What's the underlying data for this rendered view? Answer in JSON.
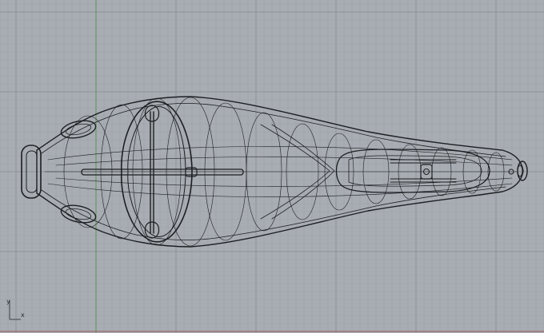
{
  "viewport": {
    "background": "#a8adb3",
    "grid_minor_color": "#9ba0a6",
    "grid_major_color": "#8e949a",
    "y_axis_color": "#5f8f5f",
    "x_axis_color": "#9b5b5b",
    "wire_color": "#1c1f22"
  },
  "axes": {
    "y_label": "y",
    "x_label": "x"
  },
  "model": {
    "name": "wireframe-object",
    "view": "top"
  }
}
